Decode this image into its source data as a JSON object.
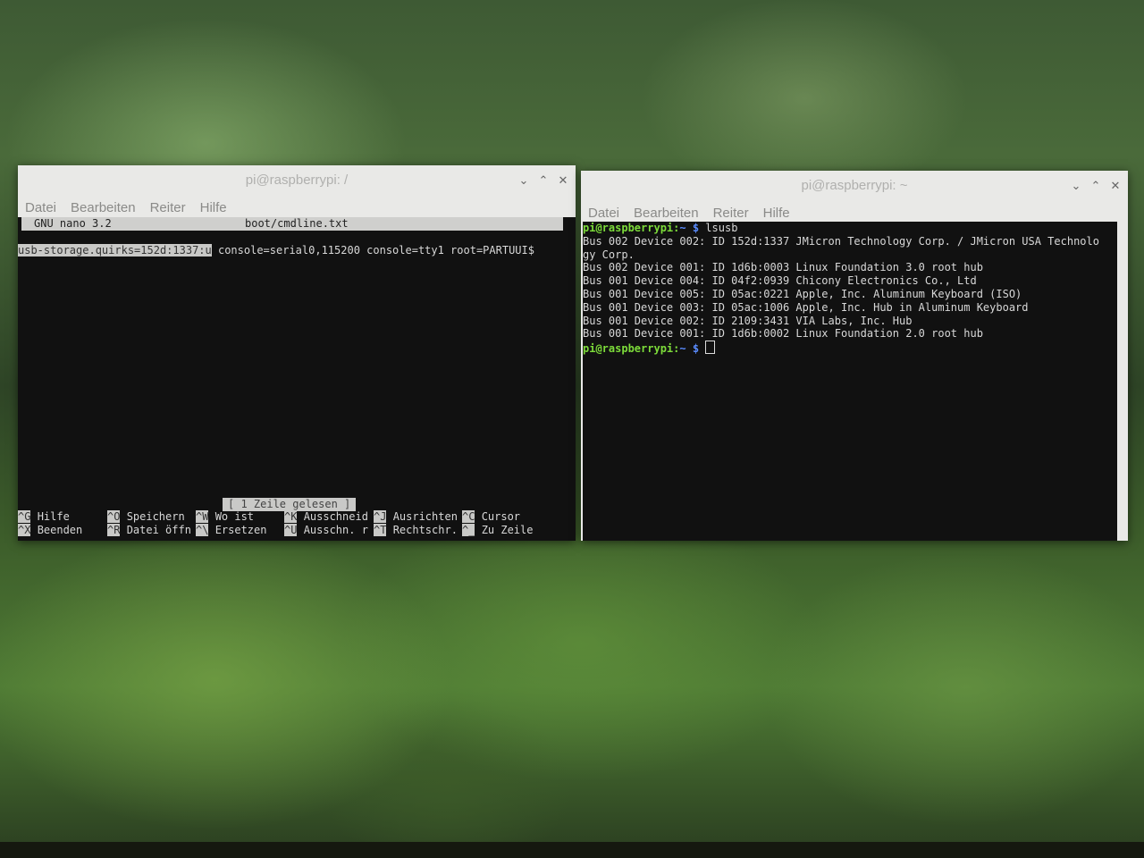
{
  "left_window": {
    "title": "pi@raspberrypi: /",
    "controls": [
      "⌄",
      "⌃",
      "✕"
    ],
    "menu": [
      "Datei",
      "Bearbeiten",
      "Reiter",
      "Hilfe"
    ],
    "nano": {
      "version": "GNU nano 3.2",
      "filename": "boot/cmdline.txt",
      "selected_text": "usb-storage.quirks=152d:1337:u",
      "rest_text": " console=serial0,115200 console=tty1 root=PARTUUI$",
      "status": "[ 1 Zeile gelesen ]",
      "shortcuts_row1": [
        {
          "key": "^G",
          "label": "Hilfe"
        },
        {
          "key": "^O",
          "label": "Speichern"
        },
        {
          "key": "^W",
          "label": "Wo ist"
        },
        {
          "key": "^K",
          "label": "Ausschneid"
        },
        {
          "key": "^J",
          "label": "Ausrichten"
        },
        {
          "key": "^C",
          "label": "Cursor"
        }
      ],
      "shortcuts_row2": [
        {
          "key": "^X",
          "label": "Beenden"
        },
        {
          "key": "^R",
          "label": "Datei öffn"
        },
        {
          "key": "^\\",
          "label": "Ersetzen"
        },
        {
          "key": "^U",
          "label": "Ausschn. r"
        },
        {
          "key": "^T",
          "label": "Rechtschr."
        },
        {
          "key": "^_",
          "label": "Zu Zeile"
        }
      ]
    }
  },
  "right_window": {
    "title": "pi@raspberrypi: ~",
    "controls": [
      "⌄",
      "⌃",
      "✕"
    ],
    "menu": [
      "Datei",
      "Bearbeiten",
      "Reiter",
      "Hilfe"
    ],
    "prompt_user": "pi@raspberrypi:",
    "prompt_path": "~ $",
    "command": "lsusb",
    "output": [
      "Bus 002 Device 002: ID 152d:1337 JMicron Technology Corp. / JMicron USA Technolo",
      "gy Corp.",
      "Bus 002 Device 001: ID 1d6b:0003 Linux Foundation 3.0 root hub",
      "Bus 001 Device 004: ID 04f2:0939 Chicony Electronics Co., Ltd",
      "Bus 001 Device 005: ID 05ac:0221 Apple, Inc. Aluminum Keyboard (ISO)",
      "Bus 001 Device 003: ID 05ac:1006 Apple, Inc. Hub in Aluminum Keyboard",
      "Bus 001 Device 002: ID 2109:3431 VIA Labs, Inc. Hub",
      "Bus 001 Device 001: ID 1d6b:0002 Linux Foundation 2.0 root hub"
    ]
  }
}
